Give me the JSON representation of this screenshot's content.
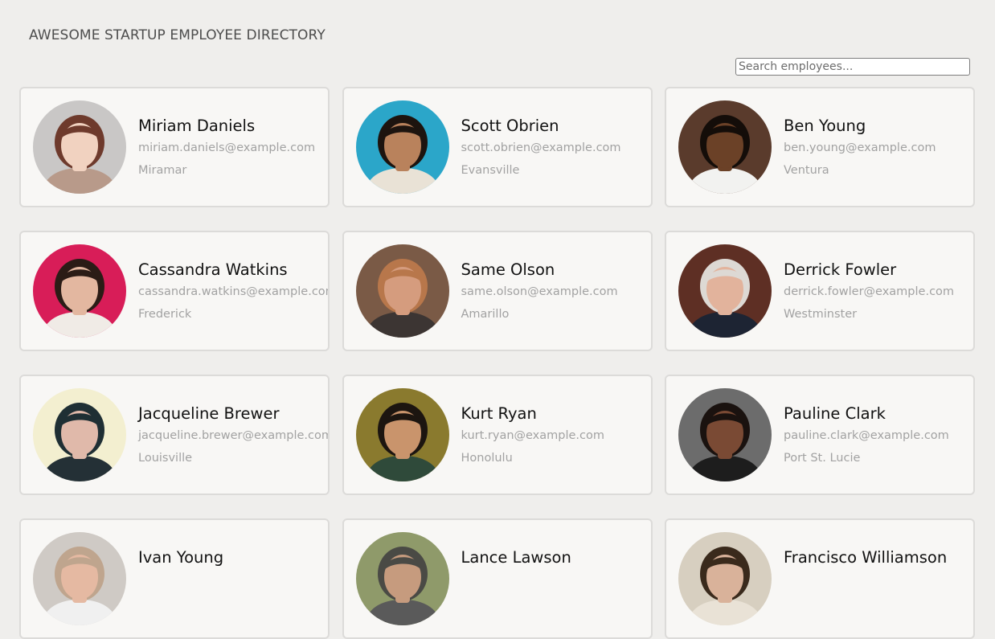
{
  "header": {
    "title": "AWESOME STARTUP EMPLOYEE DIRECTORY"
  },
  "search": {
    "placeholder": "Search employees..."
  },
  "employees": [
    {
      "name": "Miriam Daniels",
      "email": "miriam.daniels@example.com",
      "city": "Miramar",
      "bg": "#c9c7c6",
      "skin": "#f1d2c0",
      "hair": "#6e3a2c",
      "shirt": "#b89a8a"
    },
    {
      "name": "Scott Obrien",
      "email": "scott.obrien@example.com",
      "city": "Evansville",
      "bg": "#2ba6c9",
      "skin": "#b9825c",
      "hair": "#1d140f",
      "shirt": "#e9e2d6"
    },
    {
      "name": "Ben Young",
      "email": "ben.young@example.com",
      "city": "Ventura",
      "bg": "#5a3b2c",
      "skin": "#6b4127",
      "hair": "#140d09",
      "shirt": "#f2f2f0"
    },
    {
      "name": "Cassandra Watkins",
      "email": "cassandra.watkins@example.com",
      "city": "Frederick",
      "bg": "#d81d58",
      "skin": "#e3b7a0",
      "hair": "#2b1c16",
      "shirt": "#f0ebe6"
    },
    {
      "name": "Same Olson",
      "email": "same.olson@example.com",
      "city": "Amarillo",
      "bg": "#7a5a46",
      "skin": "#d59c7e",
      "hair": "#b8774b",
      "shirt": "#3c3533"
    },
    {
      "name": "Derrick Fowler",
      "email": "derrick.fowler@example.com",
      "city": "Westminster",
      "bg": "#5e2f24",
      "skin": "#e2b39c",
      "hair": "#ddd9d4",
      "shirt": "#1d2433"
    },
    {
      "name": "Jacqueline Brewer",
      "email": "jacqueline.brewer@example.com",
      "city": "Louisville",
      "bg": "#f3efd0",
      "skin": "#e0b9aa",
      "hair": "#1f2f34",
      "shirt": "#243036"
    },
    {
      "name": "Kurt Ryan",
      "email": "kurt.ryan@example.com",
      "city": "Honolulu",
      "bg": "#8a7a2e",
      "skin": "#c9946c",
      "hair": "#1c1510",
      "shirt": "#2f4a3a"
    },
    {
      "name": "Pauline Clark",
      "email": "pauline.clark@example.com",
      "city": "Port St. Lucie",
      "bg": "#6c6c6c",
      "skin": "#7a4a34",
      "hair": "#1a120f",
      "shirt": "#1d1d1d"
    },
    {
      "name": "Ivan Young",
      "email": "",
      "city": "",
      "bg": "#cfcac5",
      "skin": "#e5b9a2",
      "hair": "#bfa58e",
      "shirt": "#f0f0f0"
    },
    {
      "name": "Lance Lawson",
      "email": "",
      "city": "",
      "bg": "#8f9a6a",
      "skin": "#c69b7e",
      "hair": "#4a4a45",
      "shirt": "#5a5a5a"
    },
    {
      "name": "Francisco Williamson",
      "email": "",
      "city": "",
      "bg": "#d7cfc0",
      "skin": "#d9b29a",
      "hair": "#3a2a1c",
      "shirt": "#e9e2d6"
    }
  ]
}
